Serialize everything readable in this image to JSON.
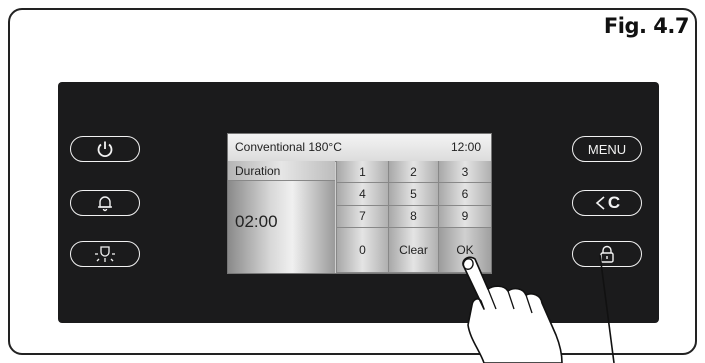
{
  "figure_label": "Fig. 4.7",
  "left_buttons": [
    {
      "name": "power-button",
      "icon": "power-icon"
    },
    {
      "name": "timer-button",
      "icon": "bell-icon"
    },
    {
      "name": "light-button",
      "icon": "lamp-icon"
    }
  ],
  "right_buttons": [
    {
      "name": "menu-button",
      "label": "MENU"
    },
    {
      "name": "back-clear-button",
      "label": "C",
      "icon": "chevron-left-icon"
    },
    {
      "name": "lock-button",
      "icon": "lock-icon"
    }
  ],
  "screen": {
    "mode_title": "Conventional 180°C",
    "clock": "12:00",
    "duration_label": "Duration",
    "duration_value": "02:00",
    "keys": [
      "1",
      "2",
      "3",
      "4",
      "5",
      "6",
      "7",
      "8",
      "9",
      "0",
      "Clear",
      "OK"
    ]
  },
  "colors": {
    "panel": "#1b1b1c",
    "button_outline": "#f2f2f2",
    "screen_bg": "#cfcfcf"
  }
}
